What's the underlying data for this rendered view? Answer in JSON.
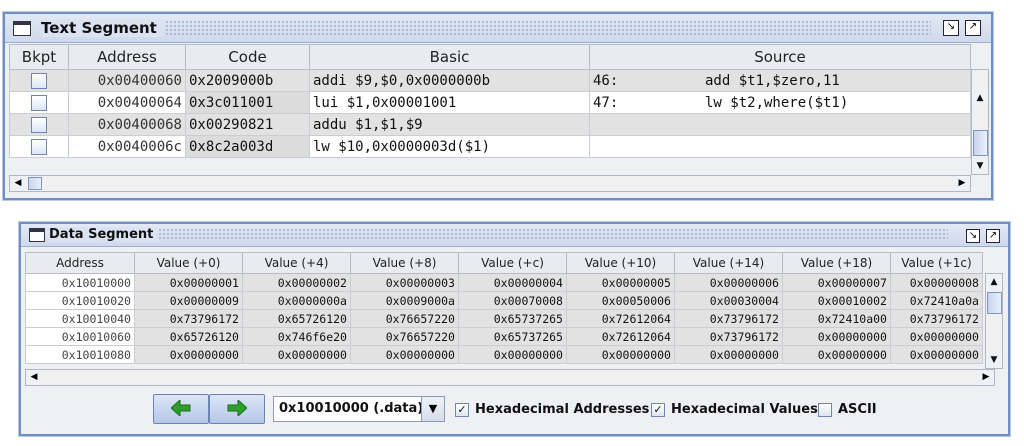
{
  "text_segment": {
    "title": "Text Segment",
    "columns": [
      "Bkpt",
      "Address",
      "Code",
      "Basic",
      "Source"
    ],
    "rows": [
      {
        "address": "0x00400060",
        "code": "0x2009000b",
        "basic": "addi $9,$0,0x0000000b",
        "source_line": "46:",
        "source": "add $t1,$zero,11"
      },
      {
        "address": "0x00400064",
        "code": "0x3c011001",
        "basic": "lui $1,0x00001001",
        "source_line": "47:",
        "source": "lw $t2,where($t1)"
      },
      {
        "address": "0x00400068",
        "code": "0x00290821",
        "basic": "addu $1,$1,$9",
        "source_line": "",
        "source": ""
      },
      {
        "address": "0x0040006c",
        "code": "0x8c2a003d",
        "basic": "lw $10,0x0000003d($1)",
        "source_line": "",
        "source": ""
      }
    ]
  },
  "data_segment": {
    "title": "Data Segment",
    "columns": [
      "Address",
      "Value (+0)",
      "Value (+4)",
      "Value (+8)",
      "Value (+c)",
      "Value (+10)",
      "Value (+14)",
      "Value (+18)",
      "Value (+1c)"
    ],
    "rows": [
      [
        "0x10010000",
        "0x00000001",
        "0x00000002",
        "0x00000003",
        "0x00000004",
        "0x00000005",
        "0x00000006",
        "0x00000007",
        "0x00000008"
      ],
      [
        "0x10010020",
        "0x00000009",
        "0x0000000a",
        "0x0009000a",
        "0x00070008",
        "0x00050006",
        "0x00030004",
        "0x00010002",
        "0x72410a0a"
      ],
      [
        "0x10010040",
        "0x73796172",
        "0x65726120",
        "0x76657220",
        "0x65737265",
        "0x72612064",
        "0x73796172",
        "0x72410a00",
        "0x73796172"
      ],
      [
        "0x10010060",
        "0x65726120",
        "0x746f6e20",
        "0x76657220",
        "0x65737265",
        "0x72612064",
        "0x73796172",
        "0x00000000",
        "0x00000000"
      ],
      [
        "0x10010080",
        "0x00000000",
        "0x00000000",
        "0x00000000",
        "0x00000000",
        "0x00000000",
        "0x00000000",
        "0x00000000",
        "0x00000000"
      ]
    ],
    "segment_select": "0x10010000 (.data)",
    "hex_addresses_label": "Hexadecimal Addresses",
    "hex_addresses_checked": true,
    "hex_values_label": "Hexadecimal Values",
    "hex_values_checked": true,
    "ascii_label": "ASCII",
    "ascii_checked": false
  },
  "colors": {
    "accent": "#6e8fc4",
    "nav_arrow": "#2e9e2e"
  }
}
